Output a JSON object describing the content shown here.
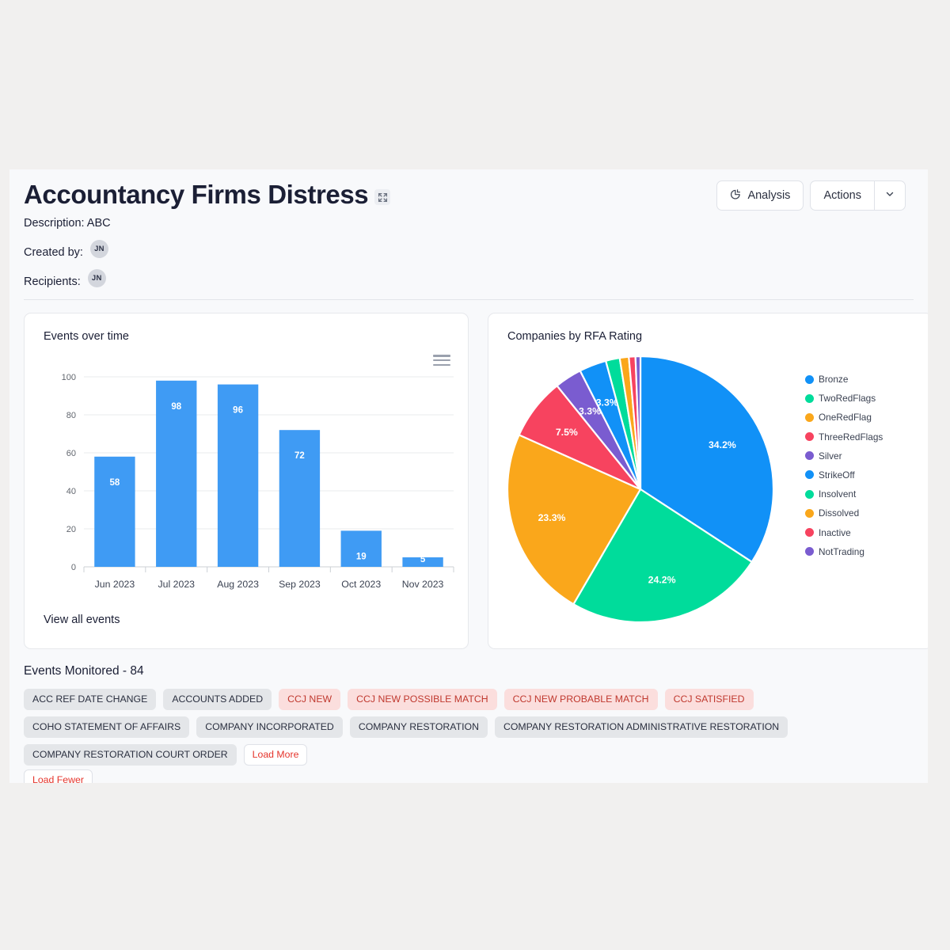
{
  "header": {
    "title": "Accountancy Firms Distress",
    "expand_icon": "expand-icon",
    "description_label": "Description: ABC",
    "created_by_label": "Created by:",
    "created_by_avatar": "JN",
    "recipients_label": "Recipients:",
    "recipients_avatar": "JN",
    "analysis_button": "Analysis",
    "analysis_icon": "pie-chart-icon",
    "actions_button": "Actions",
    "actions_caret_icon": "chevron-down-icon"
  },
  "bar_card": {
    "title": "Events over time",
    "menu_icon": "hamburger-menu-icon",
    "view_all_link": "View all events"
  },
  "pie_card": {
    "title": "Companies by RFA Rating"
  },
  "events": {
    "title": "Events Monitored - 84",
    "tags": [
      {
        "label": "ACC REF DATE CHANGE",
        "style": "grey"
      },
      {
        "label": "ACCOUNTS ADDED",
        "style": "grey"
      },
      {
        "label": "CCJ NEW",
        "style": "red"
      },
      {
        "label": "CCJ NEW POSSIBLE MATCH",
        "style": "red"
      },
      {
        "label": "CCJ NEW PROBABLE MATCH",
        "style": "red"
      },
      {
        "label": "CCJ SATISFIED",
        "style": "red"
      },
      {
        "label": "COHO STATEMENT OF AFFAIRS",
        "style": "grey"
      },
      {
        "label": "COMPANY INCORPORATED",
        "style": "grey"
      },
      {
        "label": "COMPANY RESTORATION",
        "style": "grey"
      },
      {
        "label": "COMPANY RESTORATION ADMINISTRATIVE RESTORATION",
        "style": "grey"
      },
      {
        "label": "COMPANY RESTORATION COURT ORDER",
        "style": "grey"
      },
      {
        "label": "Load More",
        "style": "link"
      }
    ],
    "load_fewer": "Load Fewer"
  },
  "colors": {
    "bar": "#3f9bf4",
    "blue": "#1191f7",
    "green": "#00dc9b",
    "orange": "#faa71b",
    "red": "#f7435f",
    "purple": "#7a5cd0",
    "tag_red_text": "#c0392f",
    "link_red": "#e5342b"
  },
  "chart_data": [
    {
      "type": "bar",
      "title": "Events over time",
      "categories": [
        "Jun 2023",
        "Jul 2023",
        "Aug 2023",
        "Sep 2023",
        "Oct 2023",
        "Nov 2023"
      ],
      "values": [
        58,
        98,
        96,
        72,
        19,
        5
      ],
      "data_labels": [
        "58",
        "98",
        "96",
        "72",
        "19",
        "5"
      ],
      "xlabel": "",
      "ylabel": "",
      "ylim": [
        0,
        100
      ],
      "yticks": [
        0,
        20,
        40,
        60,
        80,
        100
      ],
      "grid": true,
      "legend": "none",
      "series_color": "#3f9bf4"
    },
    {
      "type": "pie",
      "title": "Companies by RFA Rating",
      "legend_position": "right",
      "start_angle_deg": 0,
      "direction": "clockwise",
      "slices": [
        {
          "label": "Bronze",
          "value": 34.2,
          "display": "34.2%",
          "color": "#1191f7"
        },
        {
          "label": "TwoRedFlags",
          "value": 24.2,
          "display": "24.2%",
          "color": "#00dc9b"
        },
        {
          "label": "OneRedFlag",
          "value": 23.3,
          "display": "23.3%",
          "color": "#faa71b"
        },
        {
          "label": "ThreeRedFlags",
          "value": 7.5,
          "display": "7.5%",
          "color": "#f7435f"
        },
        {
          "label": "Silver",
          "value": 3.3,
          "display": "3.3%",
          "color": "#7a5cd0"
        },
        {
          "label": "StrikeOff",
          "value": 3.3,
          "display": "3.3%",
          "color": "#1191f7"
        },
        {
          "label": "Insolvent",
          "value": 1.7,
          "display": "",
          "color": "#00dc9b"
        },
        {
          "label": "Dissolved",
          "value": 1.1,
          "display": "",
          "color": "#faa71b"
        },
        {
          "label": "Inactive",
          "value": 0.8,
          "display": "",
          "color": "#f7435f"
        },
        {
          "label": "NotTrading",
          "value": 0.6,
          "display": "",
          "color": "#7a5cd0"
        }
      ]
    }
  ]
}
